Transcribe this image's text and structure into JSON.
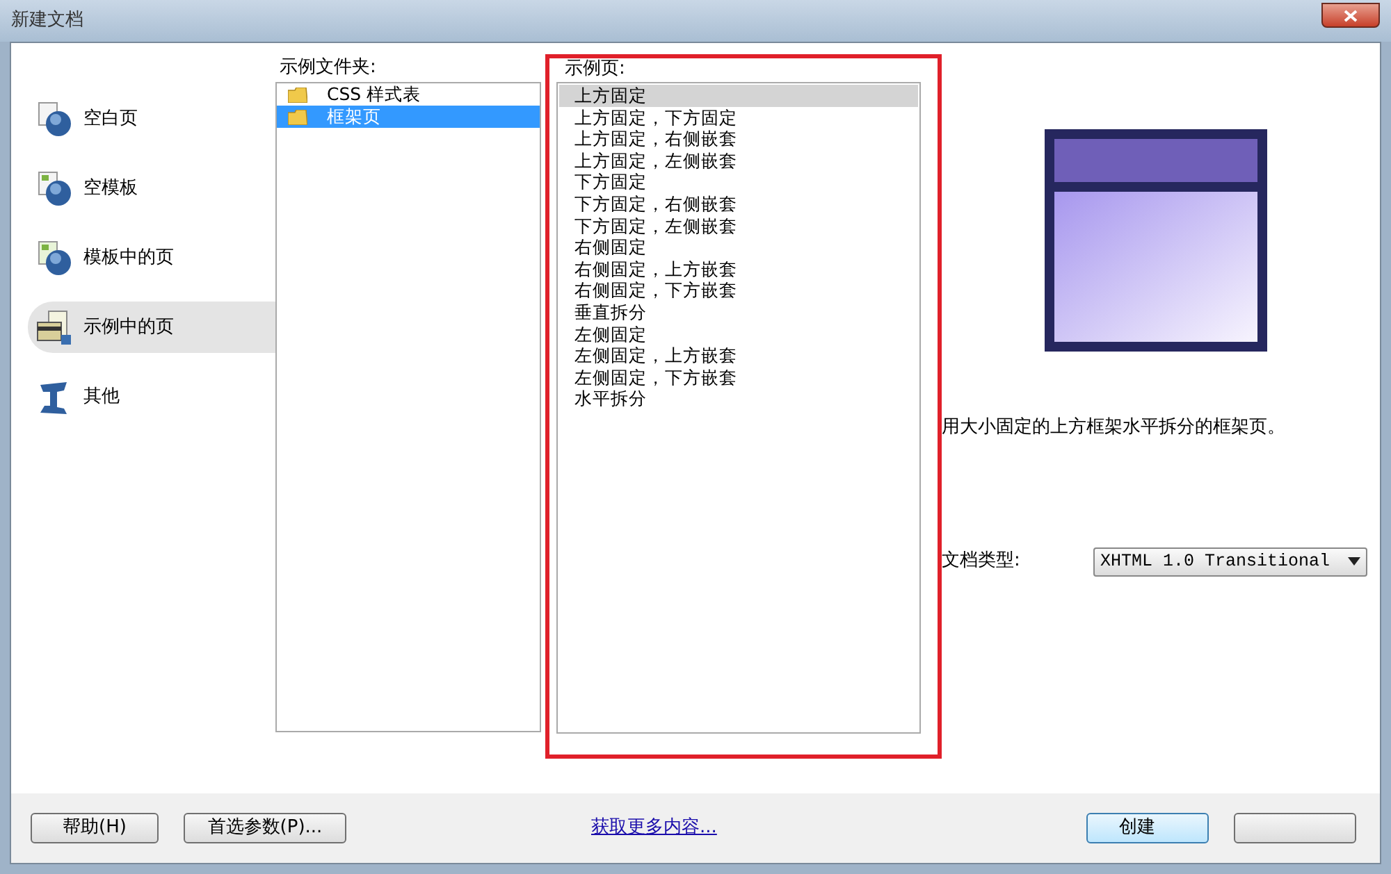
{
  "window": {
    "title": "新建文档"
  },
  "categories": [
    {
      "label": "空白页",
      "kind": "blank",
      "selected": false
    },
    {
      "label": "空模板",
      "kind": "template",
      "selected": false
    },
    {
      "label": "模板中的页",
      "kind": "template-page",
      "selected": false
    },
    {
      "label": "示例中的页",
      "kind": "sample-page",
      "selected": true
    },
    {
      "label": "其他",
      "kind": "other",
      "selected": false
    }
  ],
  "folders": {
    "label": "示例文件夹:",
    "items": [
      {
        "label": "CSS 样式表",
        "selected": false
      },
      {
        "label": "框架页",
        "selected": true
      }
    ]
  },
  "samples": {
    "label": "示例页:",
    "items": [
      {
        "label": "上方固定",
        "selected": true
      },
      {
        "label": "上方固定，下方固定",
        "selected": false
      },
      {
        "label": "上方固定，右侧嵌套",
        "selected": false
      },
      {
        "label": "上方固定，左侧嵌套",
        "selected": false
      },
      {
        "label": "下方固定",
        "selected": false
      },
      {
        "label": "下方固定，右侧嵌套",
        "selected": false
      },
      {
        "label": "下方固定，左侧嵌套",
        "selected": false
      },
      {
        "label": "右侧固定",
        "selected": false
      },
      {
        "label": "右侧固定，上方嵌套",
        "selected": false
      },
      {
        "label": "右侧固定，下方嵌套",
        "selected": false
      },
      {
        "label": "垂直拆分",
        "selected": false
      },
      {
        "label": "左侧固定",
        "selected": false
      },
      {
        "label": "左侧固定，上方嵌套",
        "selected": false
      },
      {
        "label": "左侧固定，下方嵌套",
        "selected": false
      },
      {
        "label": "水平拆分",
        "selected": false
      }
    ]
  },
  "description": "用大小固定的上方框架水平拆分的框架页。",
  "doctype": {
    "label": "文档类型:",
    "value": "XHTML 1.0 Transitional"
  },
  "footer": {
    "help": "帮助(H)",
    "preferences": "首选参数(P)...",
    "link": "获取更多内容...",
    "create": "创建"
  }
}
